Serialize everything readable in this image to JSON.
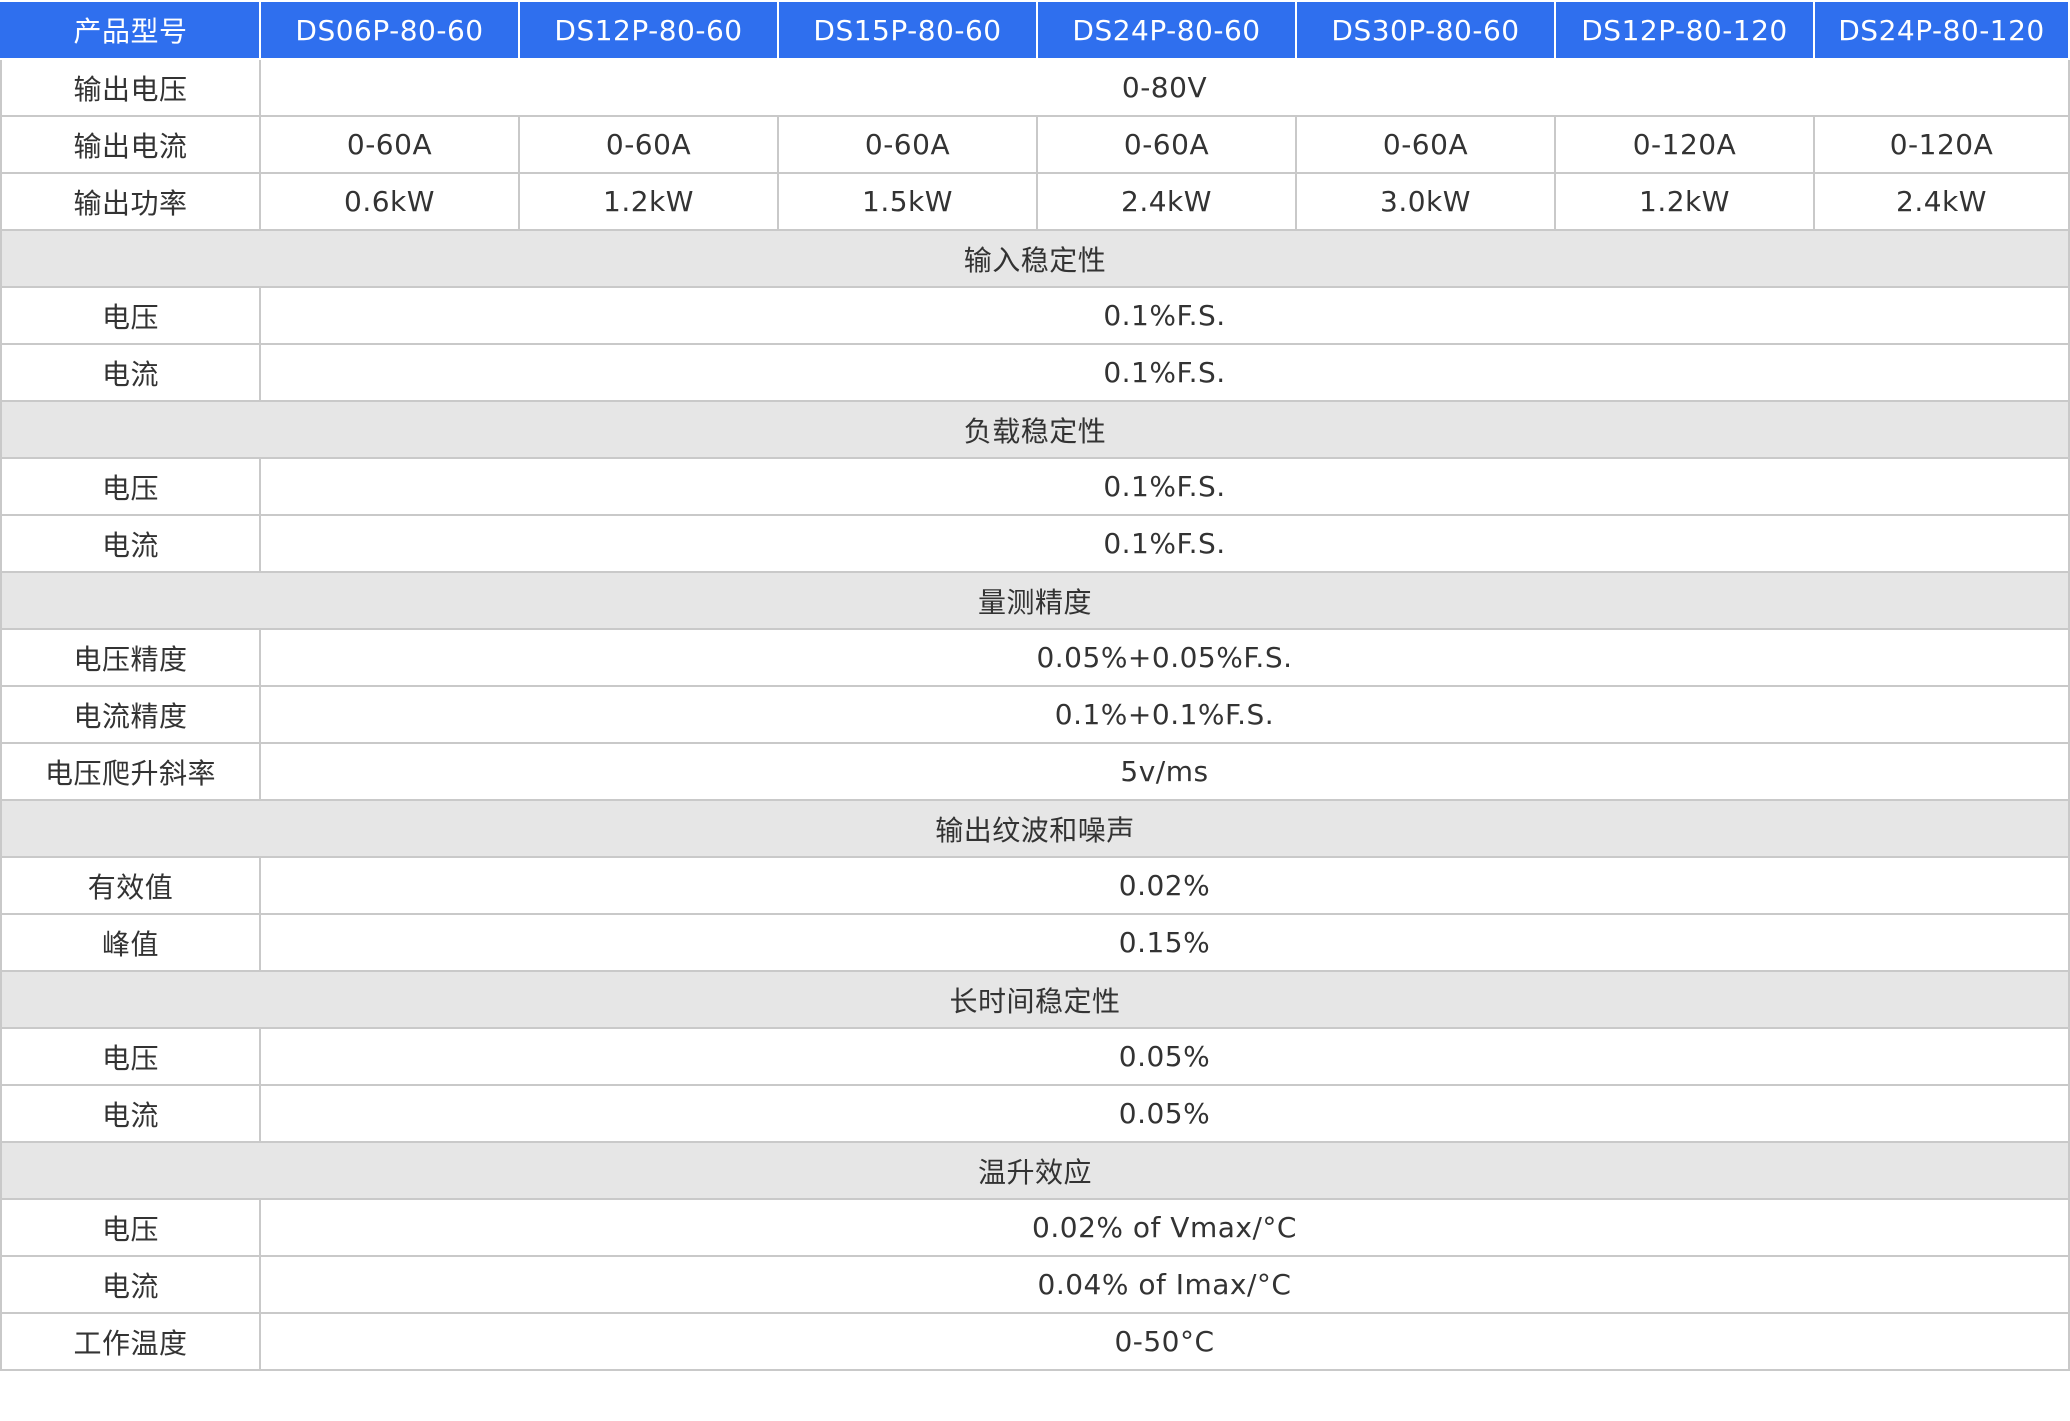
{
  "header": {
    "model_label": "产品型号",
    "models": [
      "DS06P-80-60",
      "DS12P-80-60",
      "DS15P-80-60",
      "DS24P-80-60",
      "DS30P-80-60",
      "DS12P-80-120",
      "DS24P-80-120"
    ]
  },
  "output_voltage": {
    "label": "输出电压",
    "value": "0-80V"
  },
  "output_current": {
    "label": "输出电流",
    "values": [
      "0-60A",
      "0-60A",
      "0-60A",
      "0-60A",
      "0-60A",
      "0-120A",
      "0-120A"
    ]
  },
  "output_power": {
    "label": "输出功率",
    "values": [
      "0.6kW",
      "1.2kW",
      "1.5kW",
      "2.4kW",
      "3.0kW",
      "1.2kW",
      "2.4kW"
    ]
  },
  "input_stability": {
    "title": "输入稳定性",
    "rows": [
      {
        "label": "电压",
        "value": "0.1%F.S."
      },
      {
        "label": "电流",
        "value": "0.1%F.S."
      }
    ]
  },
  "load_stability": {
    "title": "负载稳定性",
    "rows": [
      {
        "label": "电压",
        "value": "0.1%F.S."
      },
      {
        "label": "电流",
        "value": "0.1%F.S."
      }
    ]
  },
  "measurement_accuracy": {
    "title": "量测精度",
    "rows": [
      {
        "label": "电压精度",
        "value": "0.05%+0.05%F.S."
      },
      {
        "label": "电流精度",
        "value": "0.1%+0.1%F.S."
      },
      {
        "label": "电压爬升斜率",
        "value": "5v/ms"
      }
    ]
  },
  "ripple_noise": {
    "title": "输出纹波和噪声",
    "rows": [
      {
        "label": "有效值",
        "value": "0.02%"
      },
      {
        "label": "峰值",
        "value": "0.15%"
      }
    ]
  },
  "long_term_stability": {
    "title": "长时间稳定性",
    "rows": [
      {
        "label": "电压",
        "value": "0.05%"
      },
      {
        "label": "电流",
        "value": "0.05%"
      }
    ]
  },
  "temperature_effect": {
    "title": "温升效应",
    "rows": [
      {
        "label": "电压",
        "value": "0.02% of Vmax/°C"
      },
      {
        "label": "电流",
        "value": "0.04% of Imax/°C"
      },
      {
        "label": "工作温度",
        "value": "0-50°C"
      }
    ]
  },
  "colors": {
    "header_bg": "#2f6fee",
    "section_bg": "#e6e6e6",
    "border": "#c9c9c9"
  }
}
